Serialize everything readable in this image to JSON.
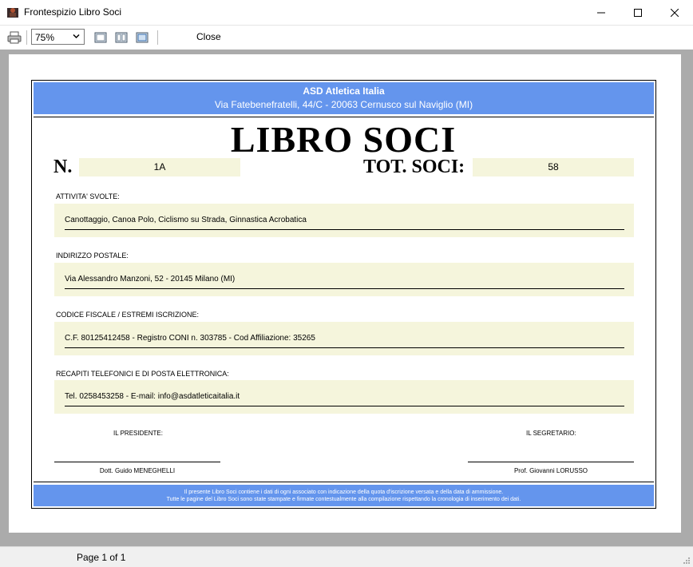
{
  "window": {
    "title": "Frontespizio Libro Soci"
  },
  "toolbar": {
    "zoom_value": "75%",
    "close_label": "Close"
  },
  "document": {
    "org_name": "ASD Atletica Italia",
    "org_address": "Via Fatebenefratelli, 44/C - 20063 Cernusco sul Naviglio (MI)",
    "main_title": "LIBRO SOCI",
    "number_label": "N.",
    "number_value": "1A",
    "total_label": "TOT. SOCI:",
    "total_value": "58",
    "sections": [
      {
        "label": "ATTIVITA' SVOLTE:",
        "value": "Canottaggio, Canoa Polo, Ciclismo su Strada, Ginnastica Acrobatica"
      },
      {
        "label": "INDIRIZZO POSTALE:",
        "value": "Via Alessandro Manzoni, 52 - 20145 Milano (MI)"
      },
      {
        "label": "CODICE FISCALE / ESTREMI ISCRIZIONE:",
        "value": "C.F. 80125412458 - Registro CONI n. 303785 - Cod Affiliazione: 35265"
      },
      {
        "label": "RECAPITI TELEFONICI E DI POSTA ELETTRONICA:",
        "value": "Tel. 0258453258 - E-mail: info@asdatleticaitalia.it"
      }
    ],
    "president_label": "IL PRESIDENTE:",
    "president_name": "Dott. Guido MENEGHELLI",
    "secretary_label": "IL SEGRETARIO:",
    "secretary_name": "Prof. Giovanni LORUSSO",
    "footer_line1": "Il presente Libro Soci contiene i dati di ogni associato con indicazione della quota d'iscrizione versata e della data di ammissione.",
    "footer_line2": "Tutte le pagine del Libro Soci sono state stampate e firmate contestualmente alla compilazione rispettando la cronologia di inserimento dei dati."
  },
  "status": {
    "page_info": "Page 1 of 1"
  },
  "colors": {
    "header_band": "#6495ed",
    "field_bg": "#f5f5dc",
    "viewer_bg": "#ababab"
  },
  "icons": [
    "app-icon",
    "minimize-icon",
    "maximize-icon",
    "close-icon",
    "print-icon",
    "one-page-icon",
    "two-page-icon",
    "three-page-icon",
    "chevron-down-icon",
    "resize-grip-icon"
  ]
}
